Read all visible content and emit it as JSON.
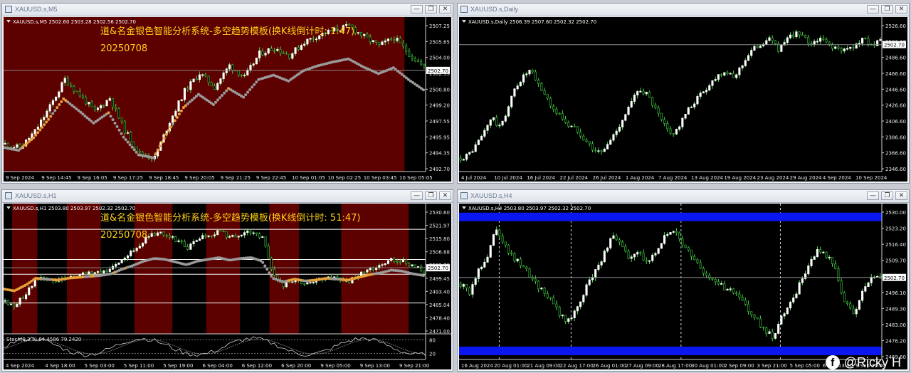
{
  "colors": {
    "bull": "#ffffff",
    "bear": "#2f9e2f",
    "wick": "#4fd04f",
    "session_red": "#5c0000",
    "ma_up": "#e6a13a",
    "ma_down": "#9a9a9a",
    "level_line": "#ffffff",
    "blue_band": "#0a17f0"
  },
  "windows": [
    {
      "id": "m5",
      "title": "XAUUSD.s,M5",
      "controls": {
        "minimize": "—",
        "restore": "❐",
        "close": "✕"
      },
      "info": "XAUUSD.s,M5  2502.60 2503.28 2502.56 2502.70",
      "overlay_title": "道&名金银色智能分析系统-多空趋势模板(换K线倒计时: 1:47)",
      "overlay_date": "20250708",
      "price_labels": [
        "2507.25",
        "2505.65",
        "2504.00",
        "2502.35",
        "2500.80",
        "2499.20",
        "2497.55",
        "2495.95",
        "2494.35",
        "2492.70"
      ],
      "price_min": 2492.7,
      "price_max": 2507.25,
      "current_price": "2502.70",
      "current_value": 2502.7,
      "time_labels": [
        "9 Sep 2024",
        "9 Sep 14:45",
        "9 Sep 16:05",
        "9 Sep 17:25",
        "9 Sep 18:45",
        "9 Sep 20:05",
        "9 Sep 21:25",
        "9 Sep 22:45",
        "10 Sep 01:05",
        "10 Sep 02:25",
        "10 Sep 03:45",
        "10 Sep 05:05"
      ],
      "session_shading": [
        [
          0,
          0.25,
          "red"
        ],
        [
          0.25,
          0.95,
          "red"
        ]
      ],
      "ma": "m5",
      "price_series": [
        2495.2,
        2494.8,
        2496.5,
        2499.0,
        2501.8,
        2500.2,
        2498.5,
        2499.9,
        2496.6,
        2494.2,
        2493.8,
        2497.5,
        2500.6,
        2502.4,
        2501.0,
        2503.2,
        2502.0,
        2504.4,
        2505.0,
        2504.2,
        2505.6,
        2506.3,
        2506.8,
        2507.2,
        2506.1,
        2505.2,
        2506.0,
        2504.4,
        2503.0
      ]
    },
    {
      "id": "daily",
      "title": "XAUUSD.s,Daily",
      "controls": {
        "minimize": "—",
        "restore": "❐",
        "close": "✕"
      },
      "info": "XAUUSD.s,Daily  2506.39 2507.60 2502.32 2502.70",
      "overlay_title": "",
      "overlay_date": "",
      "price_labels": [
        "2526.60",
        "2506.60",
        "2486.60",
        "2466.60",
        "2446.60",
        "2426.60",
        "2406.60",
        "2386.60",
        "2366.60",
        "2346.60"
      ],
      "price_min": 2346.6,
      "price_max": 2526.6,
      "current_price": "2502.70",
      "current_value": 2502.7,
      "time_labels": [
        "4 Jul 2024",
        "10 Jul 2024",
        "16 Jul 2024",
        "22 Jul 2024",
        "26 Jul 2024",
        "1 Aug 2024",
        "7 Aug 2024",
        "13 Aug 2024",
        "19 Aug 2024",
        "23 Aug 2024",
        "29 Aug 2024",
        "4 Sep 2024",
        "10 Sep 2024"
      ],
      "session_shading": [],
      "ma": "none",
      "price_series": [
        2360,
        2364,
        2376,
        2392,
        2412,
        2398,
        2420,
        2448,
        2462,
        2470,
        2452,
        2438,
        2420,
        2412,
        2400,
        2396,
        2384,
        2372,
        2366,
        2378,
        2394,
        2412,
        2430,
        2448,
        2440,
        2422,
        2404,
        2390,
        2398,
        2416,
        2430,
        2442,
        2452,
        2464,
        2470,
        2460,
        2474,
        2490,
        2500,
        2506,
        2510,
        2496,
        2508,
        2518,
        2512,
        2504,
        2510,
        2506,
        2500,
        2494,
        2498,
        2504,
        2510,
        2502,
        2506
      ]
    },
    {
      "id": "h1",
      "title": "XAUUSD.s,H1",
      "controls": {
        "minimize": "—",
        "restore": "❐",
        "close": "✕"
      },
      "info": "XAUUSD.s,H1  2503.80 2503.97 2502.32 2502.70",
      "overlay_title": "道&名金银色智能分析系统-多空趋势模板(换K线倒计时: 51:47)",
      "overlay_date": "20250708",
      "price_labels": [
        "2530.60",
        "2521.97",
        "2515.80",
        "2506.88",
        "2502.70",
        "2499.45",
        "2493.40",
        "2485.04",
        "2478.40",
        "2471.00"
      ],
      "price_min": 2471.0,
      "price_max": 2530.6,
      "current_price": "2502.70",
      "current_value": 2502.7,
      "level_values": [
        2521.97,
        2506.88,
        2499.45,
        2485.04
      ],
      "time_labels": [
        "4 Sep 2024",
        "4 Sep 18:00",
        "5 Sep 03:00",
        "5 Sep 11:00",
        "5 Sep 19:00",
        "6 Sep 04:00",
        "6 Sep 12:00",
        "6 Sep 20:00",
        "9 Sep 05:00",
        "9 Sep 13:00",
        "9 Sep 21:00"
      ],
      "session_shading": [
        [
          0.02,
          0.08,
          "red"
        ],
        [
          0.15,
          0.23,
          "red"
        ],
        [
          0.31,
          0.4,
          "red"
        ],
        [
          0.48,
          0.56,
          "red"
        ],
        [
          0.63,
          0.7,
          "red"
        ],
        [
          0.8,
          0.89,
          "red"
        ],
        [
          0.89,
          0.96,
          "red"
        ]
      ],
      "ma": "h1",
      "indicator_label": "Stoch(9,3,3) 64.4586 79.2420",
      "indicator_levels": [
        "80",
        "20"
      ],
      "price_series": [
        2486,
        2484,
        2490,
        2498,
        2497,
        2496,
        2498,
        2499,
        2500,
        2501,
        2503,
        2508,
        2512,
        2517,
        2520,
        2519,
        2516,
        2513,
        2517,
        2519,
        2521,
        2518,
        2520,
        2521,
        2517,
        2498,
        2494,
        2497,
        2495,
        2496,
        2498,
        2497,
        2496,
        2499,
        2502,
        2504,
        2507,
        2506,
        2503,
        2501
      ]
    },
    {
      "id": "h4",
      "title": "XAUUSD.s,H4",
      "controls": {
        "minimize": "—",
        "restore": "❐",
        "close": "✕"
      },
      "info": "XAUUSD.s,H4  2503.80 2503.97 2502.32 2502.70",
      "overlay_title": "",
      "overlay_date": "",
      "price_labels": [
        "2530.00",
        "2523.20",
        "2516.40",
        "2509.70",
        "2502.70",
        "2496.10",
        "2489.30",
        "2483.00",
        "2476.20",
        "2469.60"
      ],
      "price_min": 2469.6,
      "price_max": 2530.0,
      "current_price": "2502.70",
      "current_value": 2502.7,
      "time_labels": [
        "16 Aug 2024",
        "20 Aug 01:00",
        "21 Aug 09:00",
        "22 Aug 17:00",
        "26 Aug 01:00",
        "27 Aug 09:00",
        "28 Aug 17:00",
        "30 Aug 01:00",
        "2 Sep 09:00",
        "3 Sep 21:00",
        "5 Sep 05:00",
        "6 Sep 13:00",
        "9 Sep 21:00"
      ],
      "session_shading": [],
      "ma": "none",
      "blue_bands": [
        2528.0,
        2472.0
      ],
      "vertical_dashes": [
        0.095,
        0.265,
        0.525,
        0.76
      ],
      "price_series": [
        2500,
        2496,
        2506,
        2512,
        2524,
        2516,
        2510,
        2508,
        2502,
        2498,
        2494,
        2488,
        2484,
        2490,
        2498,
        2505,
        2512,
        2520,
        2516,
        2510,
        2514,
        2508,
        2515,
        2520,
        2522,
        2516,
        2512,
        2506,
        2502,
        2500,
        2497,
        2496,
        2490,
        2486,
        2480,
        2478,
        2486,
        2492,
        2500,
        2508,
        2514,
        2512,
        2506,
        2492,
        2488,
        2496,
        2502,
        2503
      ]
    }
  ],
  "watermark": {
    "icon": "facebook-icon",
    "glyph": "f",
    "handle": "@Ricky H"
  }
}
